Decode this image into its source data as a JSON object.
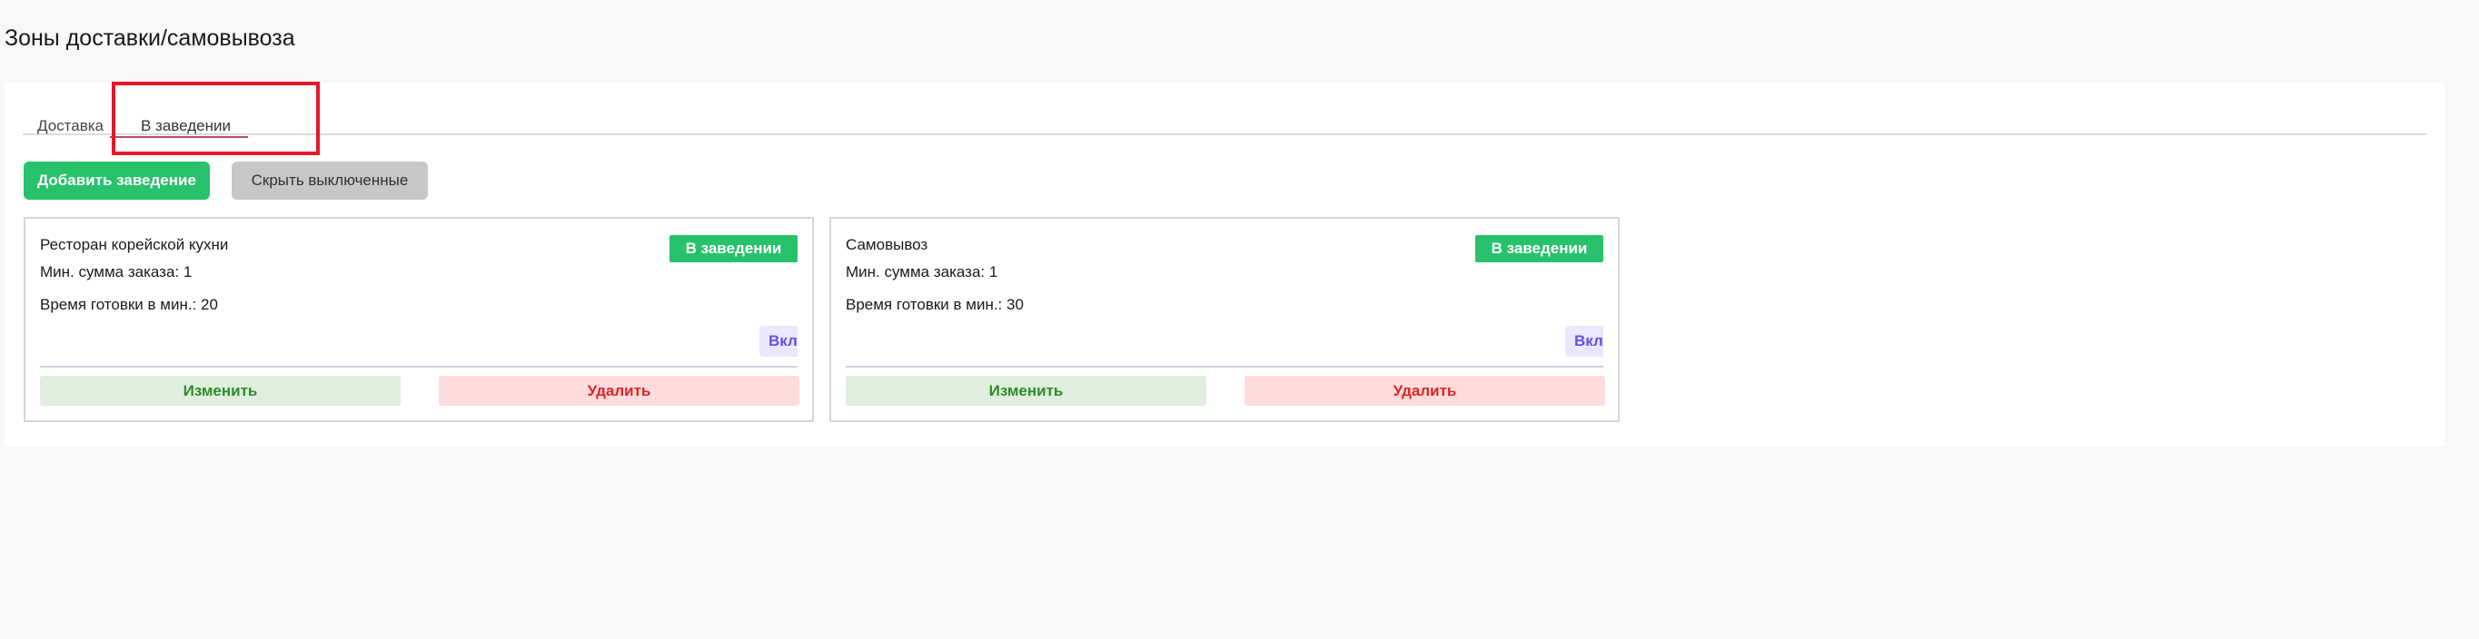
{
  "page": {
    "title": "Зоны доставки/самовывоза"
  },
  "tabs": [
    {
      "label": "Доставка",
      "active": false
    },
    {
      "label": "В заведении",
      "active": true
    }
  ],
  "toolbar": {
    "add_label": "Добавить заведение",
    "hide_label": "Скрыть выключенные"
  },
  "cards": [
    {
      "name": "Ресторан корейской кухни",
      "min_order": "Мин. сумма заказа: 1",
      "prep_time": "Время готовки в мин.: 20",
      "badge": "В заведении",
      "toggle": "Вкл",
      "edit_label": "Изменить",
      "delete_label": "Удалить"
    },
    {
      "name": "Самовывоз",
      "min_order": "Мин. сумма заказа: 1",
      "prep_time": "Время готовки в мин.: 30",
      "badge": "В заведении",
      "toggle": "Вкл",
      "edit_label": "Изменить",
      "delete_label": "Удалить"
    }
  ],
  "colors": {
    "accent_green": "#27c26b",
    "highlight_red": "#e3192b",
    "delete_red": "#e02424",
    "edit_green": "#2f8a2a",
    "toggle_purple": "#6b4ee6"
  }
}
